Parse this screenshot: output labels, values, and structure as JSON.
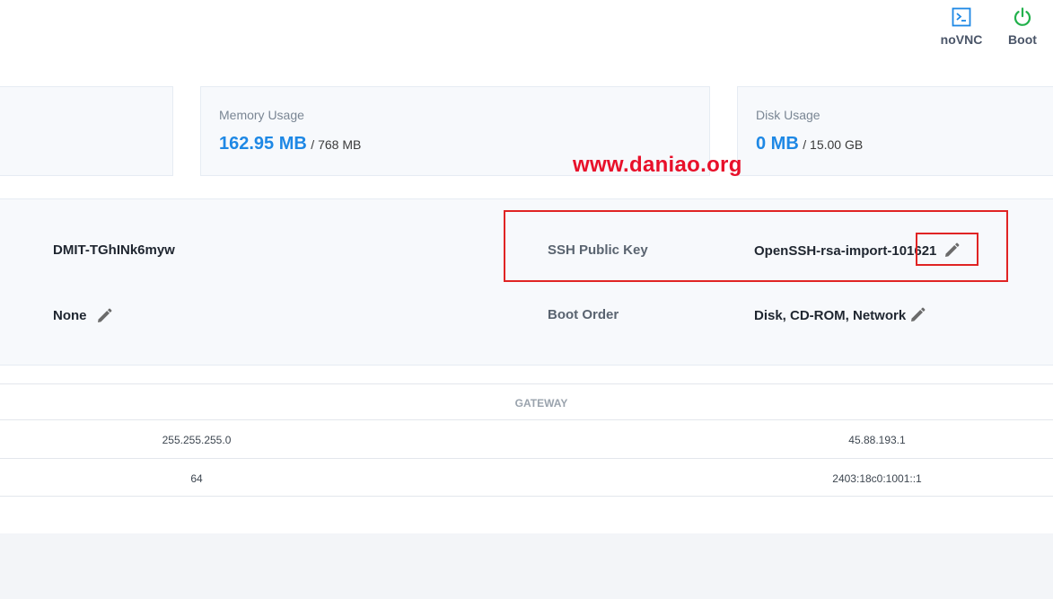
{
  "actions": {
    "novnc_label": "noVNC",
    "boot_label": "Boot",
    "novnc_color": "#1e88e5",
    "boot_color": "#22b14c"
  },
  "cards": {
    "memory": {
      "title": "Memory Usage",
      "used": "162.95 MB",
      "total": "/ 768 MB"
    },
    "disk": {
      "title": "Disk Usage",
      "used": "0 MB",
      "total": "/ 15.00 GB"
    }
  },
  "watermark": "www.daniao.org",
  "info": {
    "hostname": "DMIT-TGhINk6myw",
    "left_value_2": "None",
    "ssh_label": "SSH Public Key",
    "ssh_value": "OpenSSH-rsa-import-101621",
    "boot_order_label": "Boot Order",
    "boot_order_value": "Disk, CD-ROM, Network"
  },
  "table": {
    "headers": {
      "gateway": "GATEWAY"
    },
    "rows": [
      {
        "mask": "255.255.255.0",
        "gateway": "45.88.193.1"
      },
      {
        "mask": "64",
        "gateway": "2403:18c0:1001::1"
      }
    ]
  },
  "colors": {
    "accent": "#1e88e5",
    "highlight_box": "#e02424",
    "panel_bg": "#f7f9fc"
  }
}
